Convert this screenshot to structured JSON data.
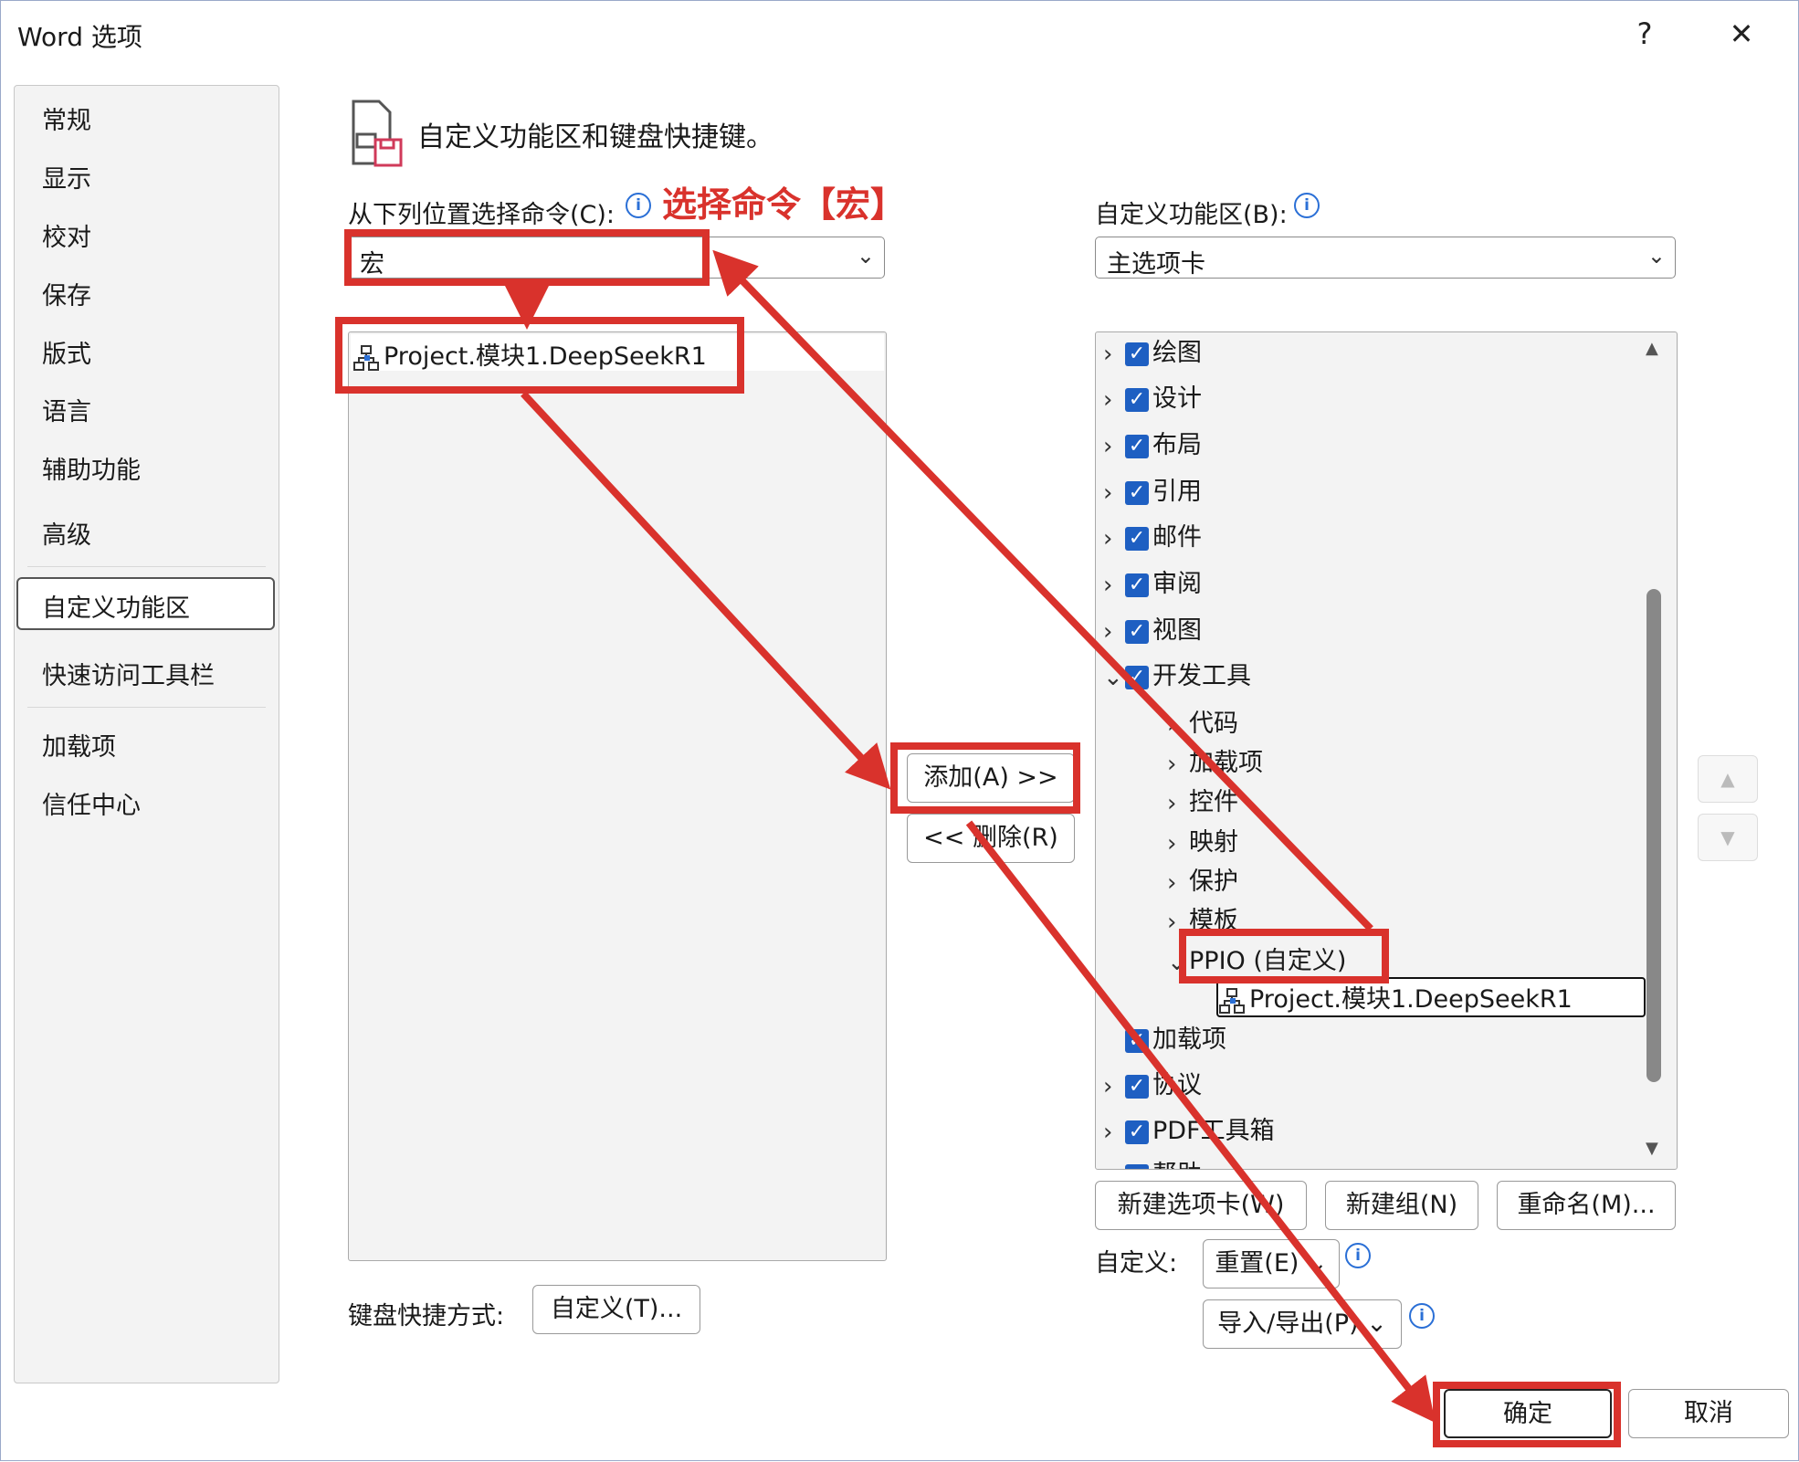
{
  "window": {
    "title": "Word 选项",
    "help": "?",
    "close": "✕"
  },
  "nav": {
    "items": [
      "常规",
      "显示",
      "校对",
      "保存",
      "版式",
      "语言",
      "辅助功能",
      "高级",
      "自定义功能区",
      "快速访问工具栏",
      "加载项",
      "信任中心"
    ],
    "selected": "自定义功能区"
  },
  "header": {
    "title": "自定义功能区和键盘快捷键。"
  },
  "left": {
    "choose_label": "从下列位置选择命令(C):",
    "choose_value": "宏",
    "commands": [
      "Project.模块1.DeepSeekR1"
    ],
    "keyboard_label": "键盘快捷方式:",
    "keyboard_button": "自定义(T)..."
  },
  "middle": {
    "add_button": "添加(A) >>",
    "remove_button": "<< 删除(R)"
  },
  "right": {
    "customize_label": "自定义功能区(B):",
    "customize_value": "主选项卡",
    "tree": [
      {
        "label": "绘图"
      },
      {
        "label": "设计"
      },
      {
        "label": "布局"
      },
      {
        "label": "引用"
      },
      {
        "label": "邮件"
      },
      {
        "label": "审阅"
      },
      {
        "label": "视图"
      },
      {
        "label": "开发工具"
      },
      {
        "label": "代码"
      },
      {
        "label": "加载项"
      },
      {
        "label": "控件"
      },
      {
        "label": "映射"
      },
      {
        "label": "保护"
      },
      {
        "label": "模板"
      },
      {
        "label": "PPIO (自定义)"
      },
      {
        "label": "Project.模块1.DeepSeekR1"
      },
      {
        "label": "加载项"
      },
      {
        "label": "协议"
      },
      {
        "label": "PDF工具箱"
      },
      {
        "label": "帮助"
      }
    ],
    "new_tab_button": "新建选项卡(W)",
    "new_group_button": "新建组(N)",
    "rename_button": "重命名(M)...",
    "customizations_label": "自定义:",
    "reset_button": "重置(E)",
    "import_export_button": "导入/导出(P)"
  },
  "footer": {
    "ok_button": "确定",
    "cancel_button": "取消"
  },
  "annotation": {
    "text": "选择命令【宏】",
    "color": "#d9322c"
  }
}
